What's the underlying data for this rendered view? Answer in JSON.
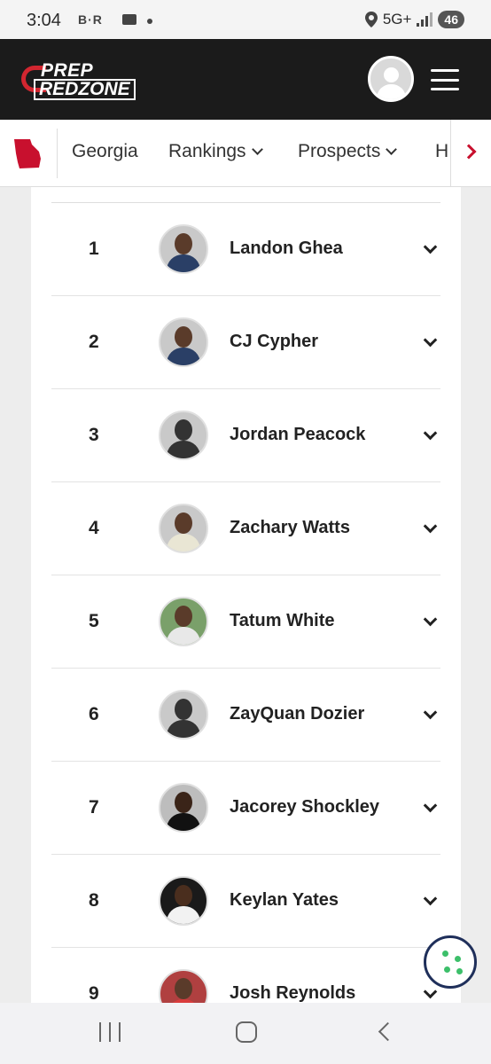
{
  "status_bar": {
    "time": "3:04",
    "apps_text": "B·R",
    "network": "5G+",
    "battery": "46"
  },
  "header": {
    "logo_top": "PREP",
    "logo_bottom": "REDZONE",
    "brand_color": "#d22630"
  },
  "nav": {
    "items": [
      {
        "label": "Georgia",
        "has_dropdown": false
      },
      {
        "label": "Rankings",
        "has_dropdown": true
      },
      {
        "label": "Prospects",
        "has_dropdown": true
      },
      {
        "label": "H",
        "has_dropdown": false
      }
    ],
    "accent": "#c8102e"
  },
  "rankings": [
    {
      "rank": "1",
      "name": "Landon Ghea",
      "photo": true
    },
    {
      "rank": "2",
      "name": "CJ Cypher",
      "photo": true
    },
    {
      "rank": "3",
      "name": "Jordan Peacock",
      "photo": false
    },
    {
      "rank": "4",
      "name": "Zachary Watts",
      "photo": true
    },
    {
      "rank": "5",
      "name": "Tatum White",
      "photo": true
    },
    {
      "rank": "6",
      "name": "ZayQuan Dozier",
      "photo": false
    },
    {
      "rank": "7",
      "name": "Jacorey Shockley",
      "photo": true
    },
    {
      "rank": "8",
      "name": "Keylan Yates",
      "photo": true
    },
    {
      "rank": "9",
      "name": "Josh Reynolds",
      "photo": true
    }
  ]
}
